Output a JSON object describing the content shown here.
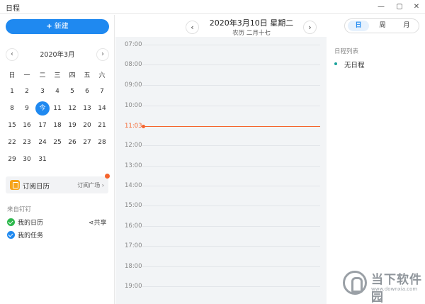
{
  "window": {
    "title": "日程",
    "controls": [
      "—",
      "▢",
      "✕"
    ]
  },
  "sidebar": {
    "new_button": "新建",
    "calendar": {
      "title": "2020年3月",
      "weekdays": [
        "日",
        "一",
        "二",
        "三",
        "四",
        "五",
        "六"
      ],
      "rows": [
        [
          "",
          "",
          "",
          "",
          "",
          "",
          ""
        ],
        [
          "1",
          "2",
          "3",
          "4",
          "5",
          "6",
          "7"
        ],
        [
          "8",
          "9",
          "今",
          "11",
          "12",
          "13",
          "14"
        ],
        [
          "15",
          "16",
          "17",
          "18",
          "19",
          "20",
          "21"
        ],
        [
          "22",
          "23",
          "24",
          "25",
          "26",
          "27",
          "28"
        ],
        [
          "29",
          "30",
          "31",
          "",
          "",
          "",
          ""
        ]
      ],
      "today_label": "今"
    },
    "subscribe": {
      "label": "订阅日历",
      "square": "订阅广场",
      "square_arrow": "›"
    },
    "source_label": "来自钉钉",
    "share": "共享",
    "calendars": [
      {
        "label": "我的日历",
        "color": "#2db84d"
      },
      {
        "label": "我的任务",
        "color": "#1f89f0"
      }
    ]
  },
  "header": {
    "date": "2020年3月10日 星期二",
    "lunar": "农历 二月十七",
    "views": [
      "日",
      "周",
      "月"
    ],
    "active_view": "日"
  },
  "timeline": {
    "hours": [
      "07:00",
      "08:00",
      "09:00",
      "10:00",
      "12:00",
      "13:00",
      "14:00",
      "15:00",
      "16:00",
      "17:00",
      "18:00",
      "19:00"
    ],
    "now": "11:03",
    "now_color": "#f5642d"
  },
  "right_panel": {
    "title": "日程列表",
    "empty": "无日程"
  },
  "watermark": {
    "name": "当下软件园",
    "url": "www.downxia.com"
  }
}
